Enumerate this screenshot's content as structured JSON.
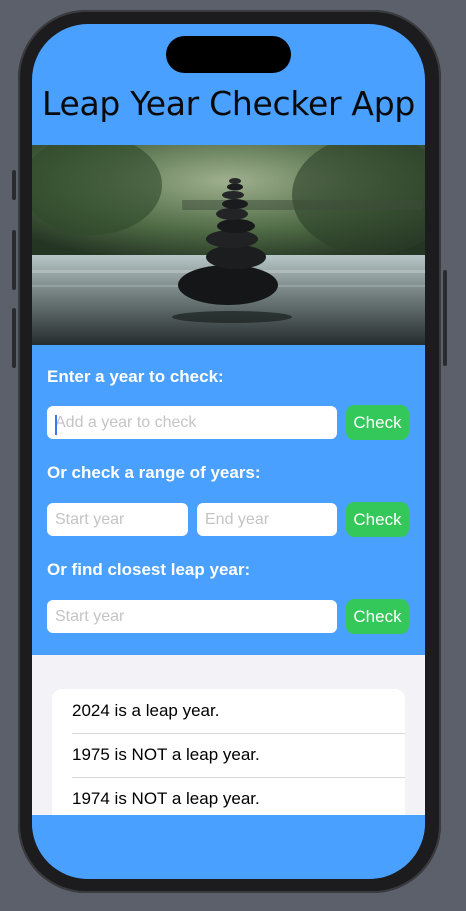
{
  "app": {
    "title": "Leap Year Checker App"
  },
  "hero": {
    "icon": "stacked-stones-photo"
  },
  "single_check": {
    "label": "Enter a year to check:",
    "placeholder": "Add a year to check",
    "value": "",
    "button_label": "Check"
  },
  "range_check": {
    "label": "Or check a range of years:",
    "start_placeholder": "Start year",
    "end_placeholder": "End year",
    "button_label": "Check"
  },
  "closest_check": {
    "label": "Or find closest leap year:",
    "placeholder": "Start year",
    "button_label": "Check"
  },
  "results": [
    "2024 is a leap year.",
    "1975 is NOT a leap year.",
    "1974 is NOT a leap year."
  ],
  "colors": {
    "header_bg": "#4aa0ff",
    "button_bg": "#34c759",
    "results_bg": "#f2f2f7"
  }
}
